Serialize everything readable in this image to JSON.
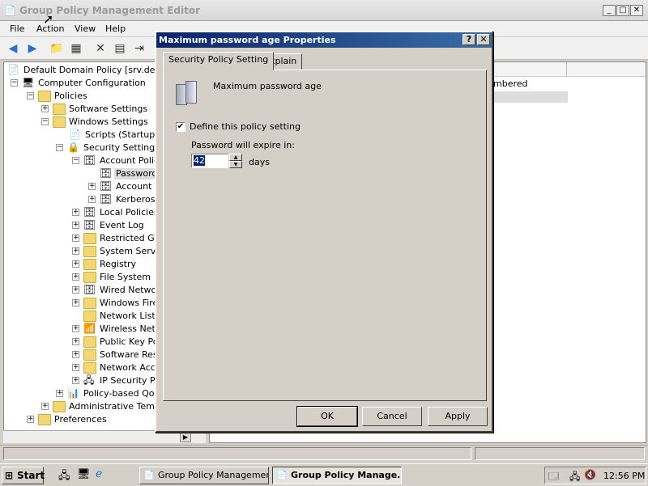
{
  "app": {
    "title": "Group Policy Management Editor"
  },
  "menu": [
    "File",
    "Action",
    "View",
    "Help"
  ],
  "tree": {
    "root": "Default Domain Policy [srv.deneme",
    "items": [
      {
        "label": "Computer Configuration"
      },
      {
        "label": "Policies"
      },
      {
        "label": "Software Settings"
      },
      {
        "label": "Windows Settings"
      },
      {
        "label": "Scripts (Startup/S"
      },
      {
        "label": "Security Settings"
      },
      {
        "label": "Account Polici"
      },
      {
        "label": "Password"
      },
      {
        "label": "Account L"
      },
      {
        "label": "Kerberos"
      },
      {
        "label": "Local Policies"
      },
      {
        "label": "Event Log"
      },
      {
        "label": "Restricted Gro"
      },
      {
        "label": "System Servic"
      },
      {
        "label": "Registry"
      },
      {
        "label": "File System"
      },
      {
        "label": "Wired Networ"
      },
      {
        "label": "Windows Firev"
      },
      {
        "label": "Network List M"
      },
      {
        "label": "Wireless Netw"
      },
      {
        "label": "Public Key Pol"
      },
      {
        "label": "Software Res"
      },
      {
        "label": "Network Acce"
      },
      {
        "label": "IP Security Po"
      },
      {
        "label": "Policy-based QoS"
      },
      {
        "label": "Administrative Templa"
      },
      {
        "label": "Preferences"
      }
    ]
  },
  "right_pane": {
    "visible_text": "mbered"
  },
  "dialog": {
    "title": "Maximum password age Properties",
    "help_btn": "?",
    "close_btn": "✕",
    "tabs": [
      "Security Policy Setting",
      "Explain"
    ],
    "policy_name": "Maximum password age",
    "checkbox_label": "Define this policy setting",
    "checkbox_checked": true,
    "expire_label": "Password will expire in:",
    "expire_value": "42",
    "expire_unit": "days",
    "buttons": {
      "ok": "OK",
      "cancel": "Cancel",
      "apply": "Apply"
    }
  },
  "taskbar": {
    "start": "Start",
    "tasks": [
      "Group Policy Management",
      "Group Policy Manage..."
    ],
    "clock": "12:56 PM"
  }
}
